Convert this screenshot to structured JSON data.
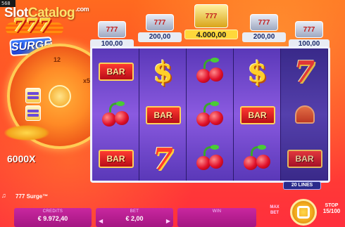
{
  "frame_tag": "568",
  "watermark": {
    "part1": "Slot",
    "part2": "Catalog",
    "suffix": ".com"
  },
  "logo": {
    "sevens": "777",
    "surge": "SURGE"
  },
  "wheel": {
    "numbers": [
      "12",
      "x5"
    ]
  },
  "multiplier": "6000X",
  "jackpots": [
    {
      "value": "100,00",
      "tier": "silver"
    },
    {
      "value": "200,00",
      "tier": "silver"
    },
    {
      "value": "4.000,00",
      "tier": "gold"
    },
    {
      "value": "200,00",
      "tier": "silver"
    },
    {
      "value": "100,00",
      "tier": "silver"
    }
  ],
  "jackpot_icon_text": "777",
  "reels": [
    [
      "BAR",
      "cherry",
      "BAR"
    ],
    [
      "dollar",
      "BAR",
      "seven"
    ],
    [
      "cherry",
      "cherry",
      "cherry"
    ],
    [
      "dollar",
      "BAR",
      "cherry"
    ],
    [
      "seven",
      "bell",
      "BAR"
    ]
  ],
  "symbol_text": {
    "bar": "BAR",
    "dollar": "$",
    "seven": "7"
  },
  "lines": "20 LINES",
  "game_name": "777 Surge™",
  "credits": {
    "label": "CREDITS",
    "value": "€ 9.972,40"
  },
  "bet": {
    "label": "BET",
    "value": "€ 2,00"
  },
  "win": {
    "label": "WIN",
    "value": ""
  },
  "max_bet": {
    "line1": "MAX",
    "line2": "BET"
  },
  "stop": {
    "label": "STOP",
    "count": "15/100"
  },
  "colors": {
    "background": "#ff4a2a",
    "reel": "#5a38b8",
    "panel": "#b51c8e",
    "gold": "#ffd83a"
  }
}
